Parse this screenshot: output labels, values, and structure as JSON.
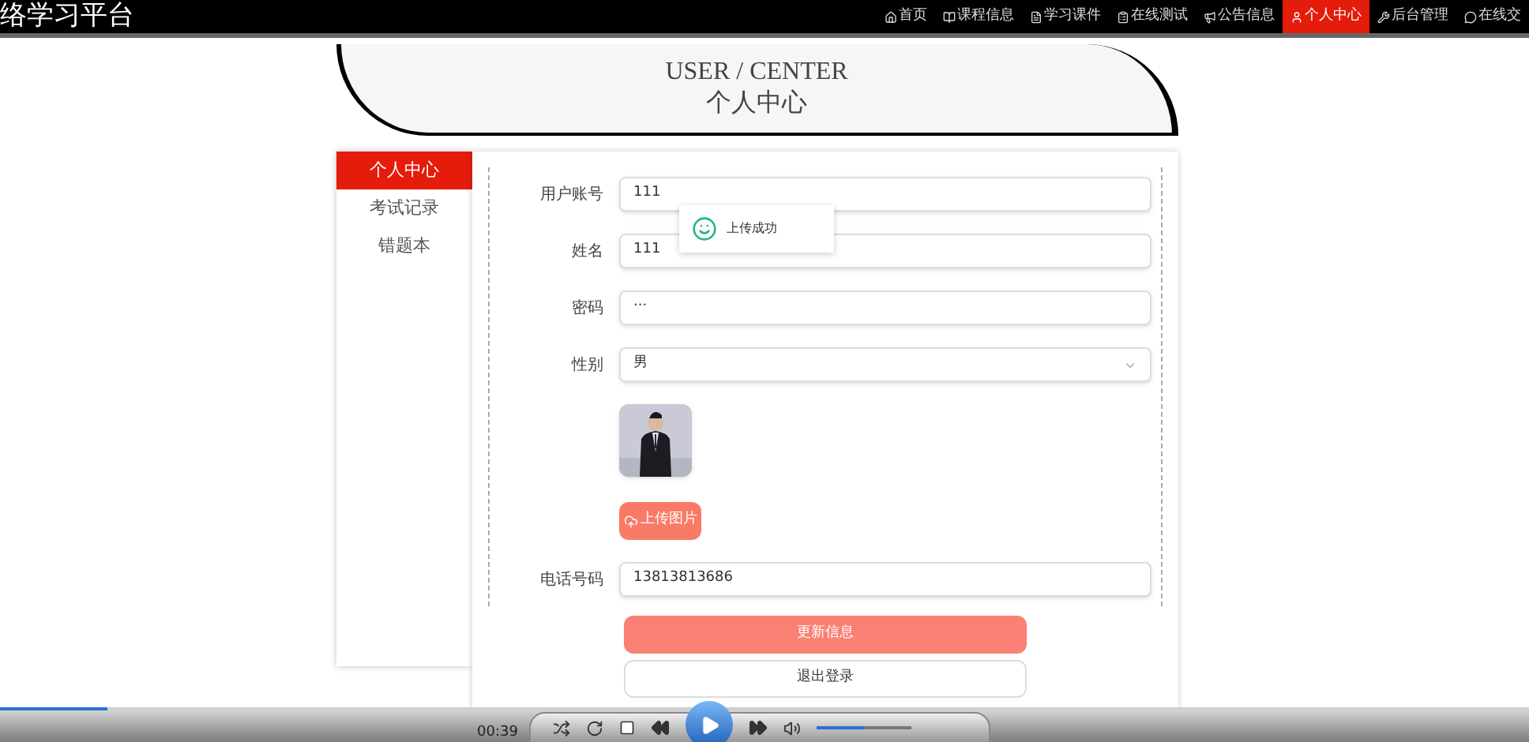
{
  "site_title": "络学习平台",
  "nav": [
    {
      "label": "首页",
      "selected": false
    },
    {
      "label": "课程信息",
      "selected": false
    },
    {
      "label": "学习课件",
      "selected": false
    },
    {
      "label": "在线测试",
      "selected": false
    },
    {
      "label": "公告信息",
      "selected": false
    },
    {
      "label": "个人中心",
      "selected": true
    },
    {
      "label": "后台管理",
      "selected": false
    },
    {
      "label": "在线交",
      "selected": false
    }
  ],
  "banner": {
    "title": "USER / CENTER",
    "subtitle": "个人中心"
  },
  "sidebar": [
    {
      "label": "个人中心",
      "selected": true
    },
    {
      "label": "考试记录",
      "selected": false
    },
    {
      "label": "错题本",
      "selected": false
    }
  ],
  "form": {
    "fields": [
      {
        "kind": "text",
        "label": "用户账号",
        "value": "111"
      },
      {
        "kind": "text",
        "label": "姓名",
        "value": "111"
      },
      {
        "kind": "text",
        "label": "密码",
        "value": "···"
      },
      {
        "kind": "select",
        "label": "性别",
        "value": "男"
      },
      {
        "button": "上传图片"
      },
      {
        "kind": "text",
        "label": "电话号码",
        "value": "13813813686"
      }
    ],
    "buttons": [
      {
        "label": "更新信息",
        "kind": "primary"
      },
      {
        "label": "退出登录",
        "kind": "plain"
      }
    ]
  },
  "toast": {
    "message": "上传成功"
  },
  "player": {
    "time": "00:39",
    "progress": {
      "level": 0.07
    },
    "volume": {
      "level": 0.5
    }
  }
}
